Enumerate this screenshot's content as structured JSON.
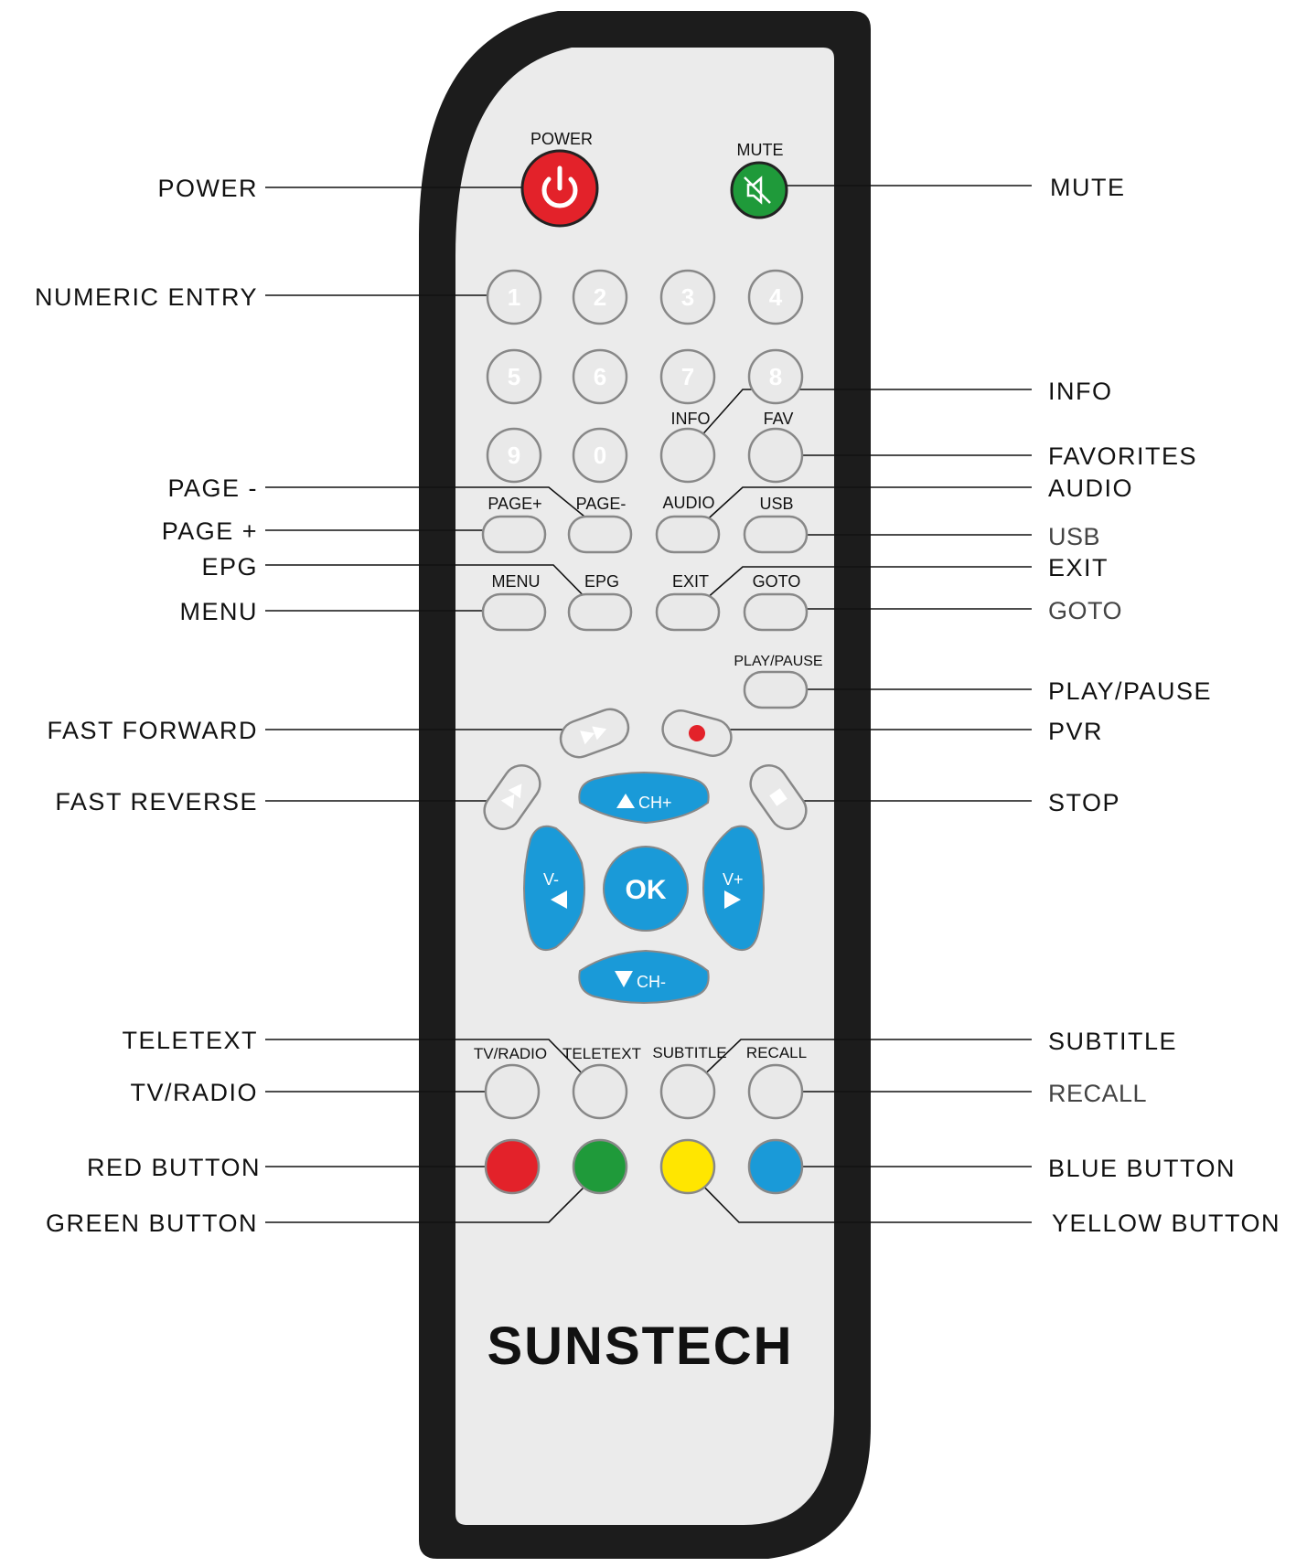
{
  "callouts": {
    "power": "POWER",
    "mute": "MUTE",
    "numeric_entry": "NUMERIC ENTRY",
    "info": "INFO",
    "favorites": "FAVORITES",
    "page_minus": "PAGE -",
    "audio": "AUDIO",
    "page_plus": "PAGE +",
    "usb": "USB",
    "epg": "EPG",
    "exit": "EXIT",
    "menu": "MENU",
    "goto": "GOTO",
    "play_pause": "PLAY/PAUSE",
    "fast_forward": "FAST FORWARD",
    "pvr": "PVR",
    "fast_reverse": "FAST REVERSE",
    "stop": "STOP",
    "teletext": "TELETEXT",
    "subtitle": "SUBTITLE",
    "tv_radio": "TV/RADIO",
    "recall": "RECALL",
    "red_button": "RED BUTTON",
    "blue_button": "BLUE BUTTON",
    "green_button": "GREEN BUTTON",
    "yellow_button": "YELLOW BUTTON"
  },
  "buttons": {
    "power": "POWER",
    "mute": "MUTE",
    "digits": [
      "1",
      "2",
      "3",
      "4",
      "5",
      "6",
      "7",
      "8",
      "9",
      "0"
    ],
    "info": "INFO",
    "fav": "FAV",
    "page_plus": "PAGE+",
    "page_minus": "PAGE-",
    "audio": "AUDIO",
    "usb": "USB",
    "menu": "MENU",
    "epg": "EPG",
    "exit": "EXIT",
    "goto": "GOTO",
    "play_pause": "PLAY/PAUSE",
    "ch_plus": "CH+",
    "ch_minus": "CH-",
    "vol_minus": "V-",
    "vol_plus": "V+",
    "ok": "OK",
    "tv_radio": "TV/RADIO",
    "teletext": "TELETEXT",
    "subtitle": "SUBTITLE",
    "recall": "RECALL"
  },
  "brand": "SUNSTECH",
  "colors": {
    "power": "#e3222a",
    "mute": "#1f9a3a",
    "nav": "#1a9ad8",
    "red": "#e3222a",
    "green": "#1f9a3a",
    "yellow": "#ffe600",
    "blue": "#1a9ad8",
    "pvr_dot": "#e3222a"
  }
}
